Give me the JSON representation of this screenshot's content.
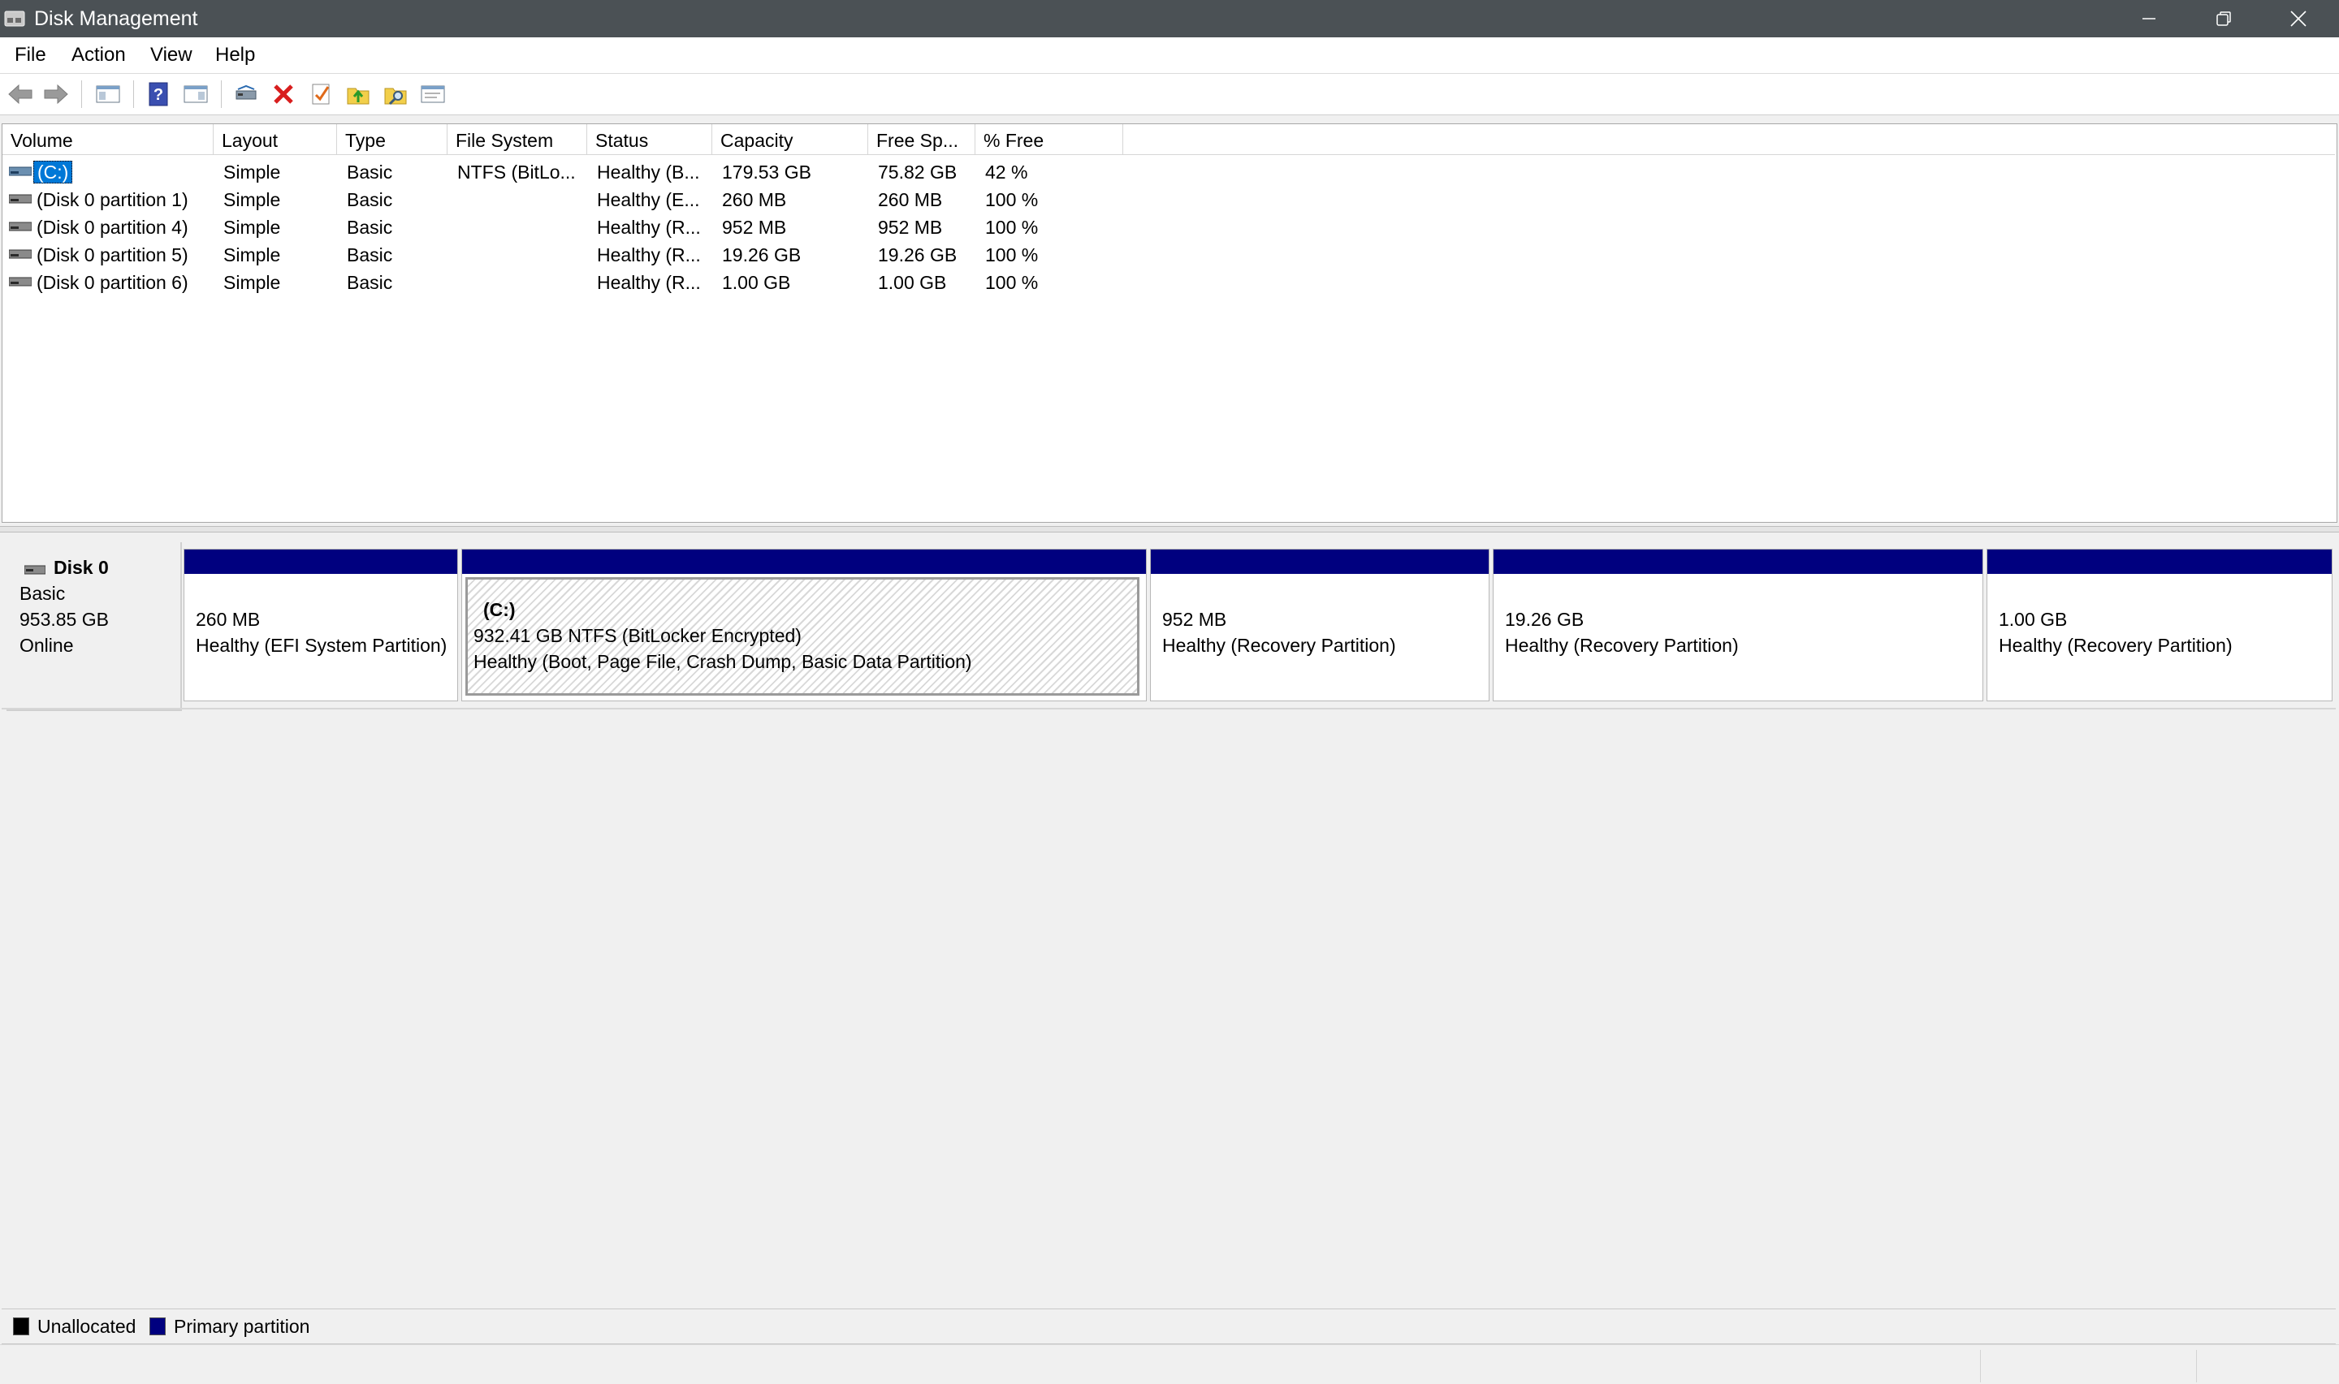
{
  "window": {
    "title": "Disk Management",
    "controls": [
      "minimize-icon",
      "restore-icon",
      "close-icon"
    ]
  },
  "menu": [
    "File",
    "Action",
    "View",
    "Help"
  ],
  "toolbar": {
    "icons": [
      "back-arrow-icon",
      "forward-arrow-icon",
      "show-hide-console-tree-icon",
      "help-icon",
      "show-hide-action-pane-icon",
      "rescan-disks-icon",
      "delete-icon",
      "checklist-icon",
      "import-folder-icon",
      "search-folder-icon",
      "properties-icon"
    ]
  },
  "volume_list": {
    "columns": [
      "Volume",
      "Layout",
      "Type",
      "File System",
      "Status",
      "Capacity",
      "Free Sp...",
      "% Free"
    ],
    "rows": [
      {
        "volume": "(C:)",
        "layout": "Simple",
        "type": "Basic",
        "fs": "NTFS (BitLo...",
        "status": "Healthy (B...",
        "capacity": "179.53 GB",
        "free": "75.82 GB",
        "pct": "42 %"
      },
      {
        "volume": "(Disk 0 partition 1)",
        "layout": "Simple",
        "type": "Basic",
        "fs": "",
        "status": "Healthy (E...",
        "capacity": "260 MB",
        "free": "260 MB",
        "pct": "100 %"
      },
      {
        "volume": "(Disk 0 partition 4)",
        "layout": "Simple",
        "type": "Basic",
        "fs": "",
        "status": "Healthy (R...",
        "capacity": "952 MB",
        "free": "952 MB",
        "pct": "100 %"
      },
      {
        "volume": "(Disk 0 partition 5)",
        "layout": "Simple",
        "type": "Basic",
        "fs": "",
        "status": "Healthy (R...",
        "capacity": "19.26 GB",
        "free": "19.26 GB",
        "pct": "100 %"
      },
      {
        "volume": "(Disk 0 partition 6)",
        "layout": "Simple",
        "type": "Basic",
        "fs": "",
        "status": "Healthy (R...",
        "capacity": "1.00 GB",
        "free": "1.00 GB",
        "pct": "100 %"
      }
    ]
  },
  "disk": {
    "name": "Disk 0",
    "type": "Basic",
    "size": "953.85 GB",
    "state": "Online",
    "partitions": [
      {
        "label": "",
        "size": "260 MB",
        "status": "Healthy (EFI System Partition)"
      },
      {
        "label": "(C:)",
        "size": "932.41 GB NTFS (BitLocker Encrypted)",
        "status": "Healthy (Boot, Page File, Crash Dump, Basic Data Partition)"
      },
      {
        "label": "",
        "size": "952 MB",
        "status": "Healthy (Recovery Partition)"
      },
      {
        "label": "",
        "size": "19.26 GB",
        "status": "Healthy (Recovery Partition)"
      },
      {
        "label": "",
        "size": "1.00 GB",
        "status": "Healthy (Recovery Partition)"
      }
    ]
  },
  "legend": [
    {
      "label": "Unallocated",
      "color": "#000000"
    },
    {
      "label": "Primary partition",
      "color": "#00007f"
    }
  ],
  "colors": {
    "primary_partition": "#00007f",
    "selection": "#0078d7",
    "titlebar": "#4b5155"
  }
}
